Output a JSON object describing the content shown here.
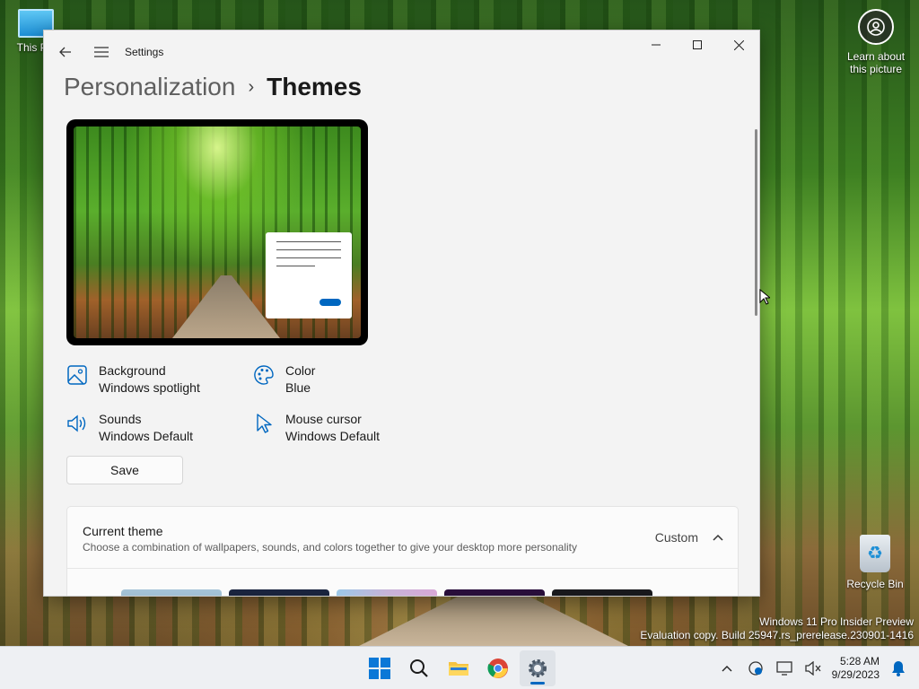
{
  "desktop": {
    "this_pc_label": "This PC",
    "learn_label": "Learn about this picture",
    "recycle_label": "Recycle Bin",
    "watermark_line1": "Windows 11 Pro Insider Preview",
    "watermark_line2": "Evaluation copy. Build 25947.rs_prerelease.230901-1416"
  },
  "window": {
    "app_title": "Settings",
    "breadcrumb_parent": "Personalization",
    "breadcrumb_separator": "›",
    "breadcrumb_current": "Themes"
  },
  "theme_props": {
    "background_label": "Background",
    "background_value": "Windows spotlight",
    "color_label": "Color",
    "color_value": "Blue",
    "sounds_label": "Sounds",
    "sounds_value": "Windows Default",
    "cursor_label": "Mouse cursor",
    "cursor_value": "Windows Default"
  },
  "save_label": "Save",
  "current_theme": {
    "title": "Current theme",
    "description": "Choose a combination of wallpapers, sounds, and colors together to give your desktop more personality",
    "value": "Custom"
  },
  "taskbar": {
    "time": "5:28 AM",
    "date": "9/29/2023",
    "apps": [
      "start-icon",
      "search-icon",
      "file-explorer-icon",
      "chrome-icon",
      "settings-icon"
    ]
  },
  "colors": {
    "accent": "#0067c0",
    "window_bg": "#f3f3f3"
  }
}
